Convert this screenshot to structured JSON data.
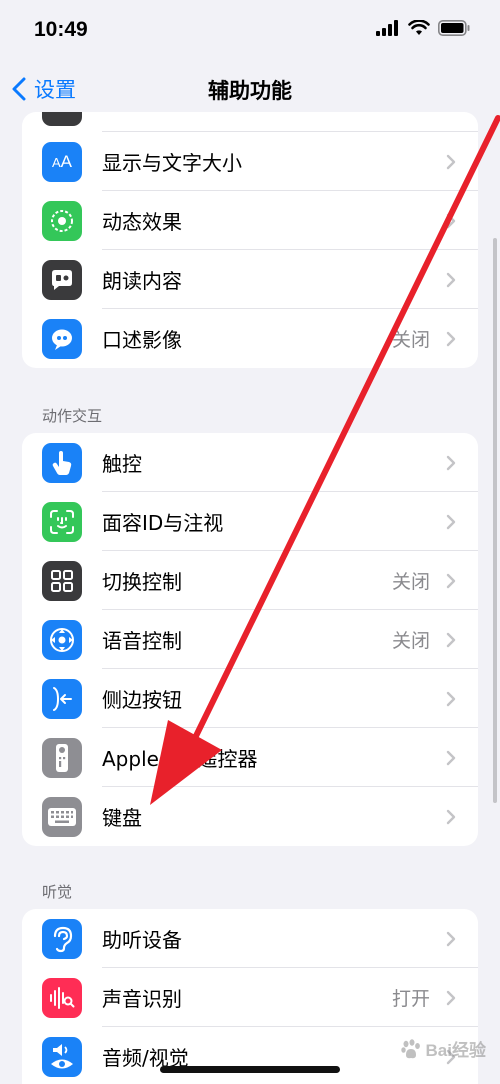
{
  "status_bar": {
    "time": "10:49"
  },
  "nav": {
    "back_label": "设置",
    "title": "辅助功能"
  },
  "groups": [
    {
      "header": "",
      "rows": [
        {
          "label": "显示与文字大小",
          "value": "",
          "icon": "text-size-icon",
          "color": "#1a82f7"
        },
        {
          "label": "动态效果",
          "value": "",
          "icon": "motion-icon",
          "color": "#34c759"
        },
        {
          "label": "朗读内容",
          "value": "",
          "icon": "spoken-content-icon",
          "color": "#3a3a3c"
        },
        {
          "label": "口述影像",
          "value": "关闭",
          "icon": "audio-description-icon",
          "color": "#1a82f7"
        }
      ]
    },
    {
      "header": "动作交互",
      "rows": [
        {
          "label": "触控",
          "value": "",
          "icon": "touch-icon",
          "color": "#1a82f7"
        },
        {
          "label": "面容ID与注视",
          "value": "",
          "icon": "face-id-icon",
          "color": "#34c759"
        },
        {
          "label": "切换控制",
          "value": "关闭",
          "icon": "switch-control-icon",
          "color": "#3a3a3c"
        },
        {
          "label": "语音控制",
          "value": "关闭",
          "icon": "voice-control-icon",
          "color": "#1a82f7"
        },
        {
          "label": "侧边按钮",
          "value": "",
          "icon": "side-button-icon",
          "color": "#1a82f7"
        },
        {
          "label": "Apple TV 遥控器",
          "value": "",
          "icon": "apple-tv-remote-icon",
          "color": "#8e8e93"
        },
        {
          "label": "键盘",
          "value": "",
          "icon": "keyboard-icon",
          "color": "#8e8e93"
        }
      ]
    },
    {
      "header": "听觉",
      "rows": [
        {
          "label": "助听设备",
          "value": "",
          "icon": "hearing-device-icon",
          "color": "#1a82f7"
        },
        {
          "label": "声音识别",
          "value": "打开",
          "icon": "sound-recognition-icon",
          "color": "#ff2d55"
        },
        {
          "label": "音频/视觉",
          "value": "",
          "icon": "audio-visual-icon",
          "color": "#1a82f7"
        }
      ]
    }
  ],
  "watermark": {
    "text": "Bai经验"
  },
  "annotation": {
    "color": "#e8212b"
  },
  "colors": {
    "accent": "#0a7aff",
    "background": "#f2f2f7"
  }
}
